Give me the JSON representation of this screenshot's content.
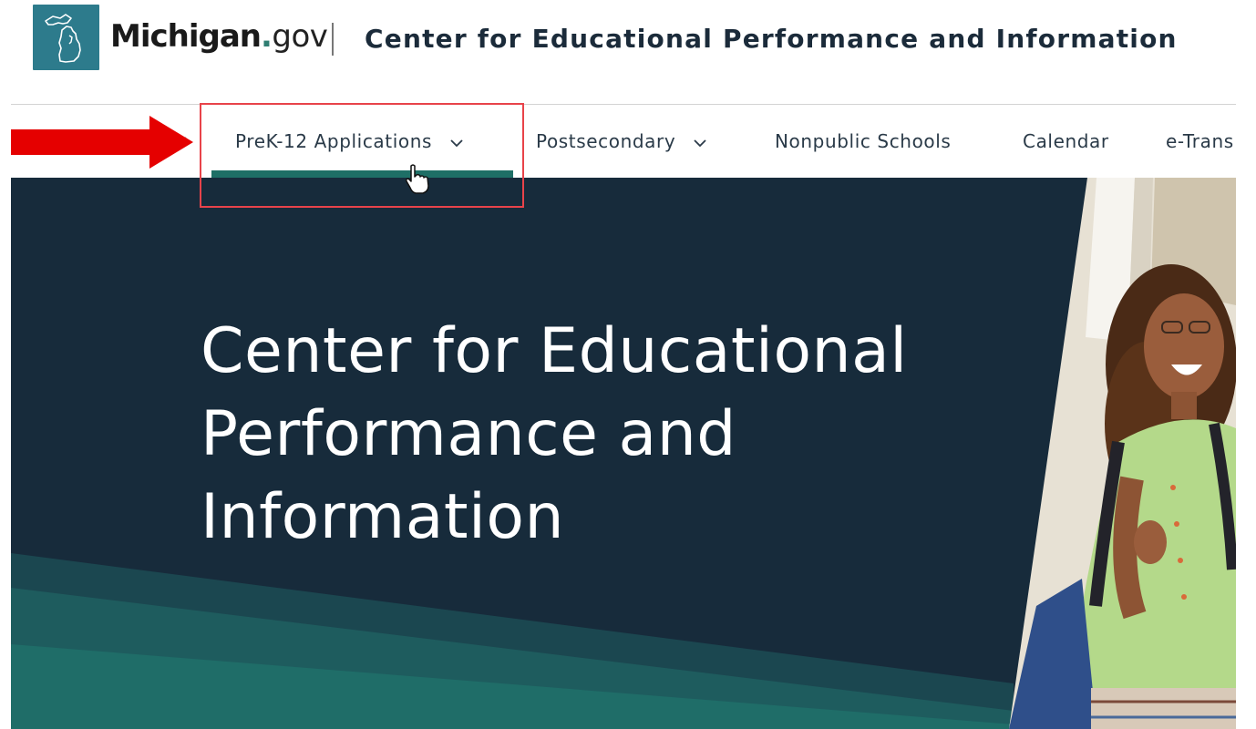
{
  "header": {
    "brand_main": "Michigan",
    "brand_dot": ".",
    "brand_tld": "gov",
    "site_title": "Center for Educational Performance and Information"
  },
  "nav": {
    "items": [
      {
        "label": "PreK-12 Applications",
        "has_dropdown": true,
        "active": true
      },
      {
        "label": "Postsecondary",
        "has_dropdown": true,
        "active": false
      },
      {
        "label": "Nonpublic Schools",
        "has_dropdown": false,
        "active": false
      },
      {
        "label": "Calendar",
        "has_dropdown": false,
        "active": false
      },
      {
        "label": "e-Trans",
        "has_dropdown": false,
        "active": false
      }
    ]
  },
  "hero": {
    "title_lines": [
      "Center for Educational",
      "Performance and",
      "Information"
    ]
  },
  "colors": {
    "logo_teal": "#2d7b8c",
    "brand_dot_green": "#2f7e72",
    "hero_navy": "#172b3b",
    "hero_teal": "#1e6f66",
    "nav_active_bar": "#1e6f66",
    "annotation_red": "#e8434a",
    "arrow_red": "#e50000"
  },
  "icons": {
    "logo": "michigan-state-outline-icon",
    "dropdown": "chevron-down-icon",
    "arrow": "red-arrow-annotation-icon",
    "cursor": "hand-pointer-cursor-icon"
  }
}
